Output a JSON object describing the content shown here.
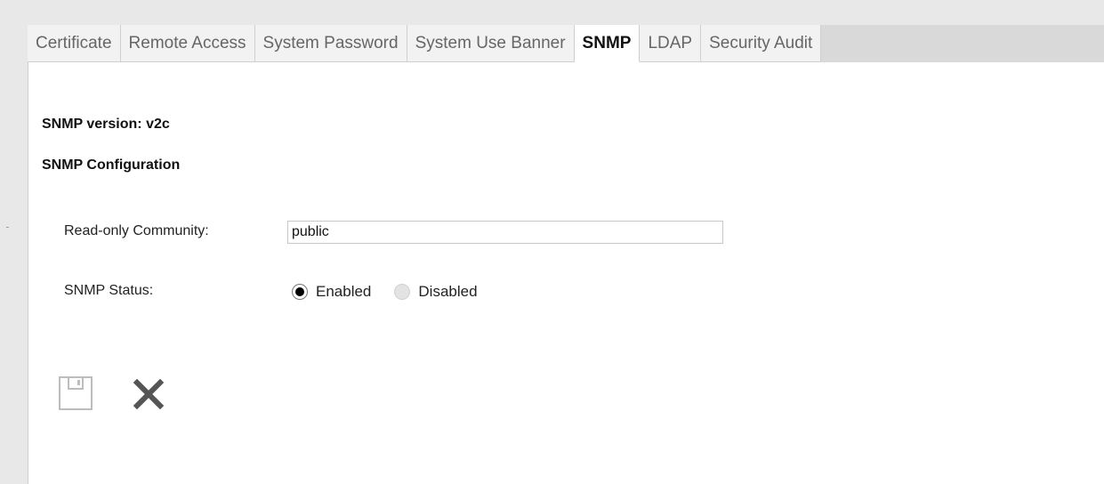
{
  "tabs": [
    {
      "label": "Certificate",
      "active": false
    },
    {
      "label": "Remote Access",
      "active": false
    },
    {
      "label": "System Password",
      "active": false
    },
    {
      "label": "System Use Banner",
      "active": false
    },
    {
      "label": "SNMP",
      "active": true
    },
    {
      "label": "LDAP",
      "active": false
    },
    {
      "label": "Security Audit",
      "active": false
    }
  ],
  "snmp": {
    "version_text": "SNMP version: v2c",
    "config_heading": "SNMP Configuration",
    "community_label": "Read-only Community:",
    "community_value": "public",
    "status_label": "SNMP Status:",
    "status_options": [
      "Enabled",
      "Disabled"
    ],
    "status_selected": "Enabled"
  },
  "actions": {
    "save_icon": "save-icon",
    "cancel_icon": "close-icon"
  }
}
